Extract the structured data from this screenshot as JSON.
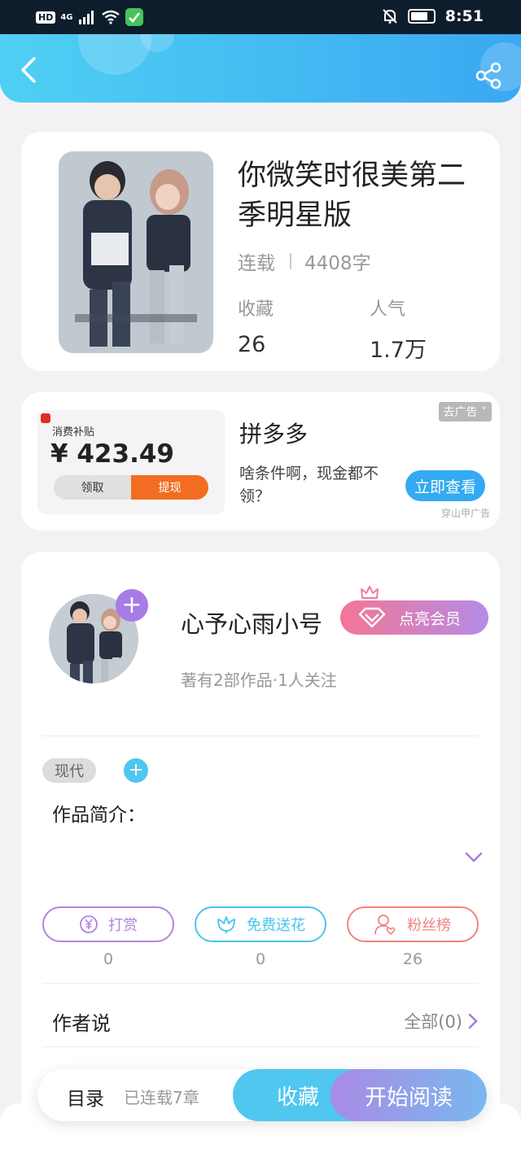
{
  "status_bar": {
    "hd": "HD",
    "network": "4G",
    "time": "8:51"
  },
  "book": {
    "title": "你微笑时很美第二季明星版",
    "status": "连载",
    "word_count": "4408字",
    "favorites_label": "收藏",
    "favorites_value": "26",
    "popularity_label": "人气",
    "popularity_value": "1.7万"
  },
  "ad": {
    "image_subtitle": "消费补贴",
    "image_amount": "¥ 423.49",
    "image_btn_claim": "领取",
    "image_btn_withdraw": "提现",
    "title": "拼多多",
    "description": "啥条件啊，现金都不领？",
    "close_label": "去广告",
    "cta": "立即查看",
    "source": "穿山甲广告"
  },
  "author": {
    "name": "心予心雨小号",
    "vip_label": "点亮会员",
    "stats": "著有2部作品·1人关注"
  },
  "tags": [
    "现代"
  ],
  "intro_label": "作品简介：",
  "actions": [
    {
      "label": "打赏",
      "count": "0",
      "color": "#b184e0"
    },
    {
      "label": "免费送花",
      "count": "0",
      "color": "#49c4ee"
    },
    {
      "label": "粉丝榜",
      "count": "26",
      "color": "#f0847e"
    }
  ],
  "author_says": {
    "label": "作者说",
    "all": "全部(0)"
  },
  "bottom_bar": {
    "toc_label": "目录",
    "toc_status": "已连载7章",
    "favorite_btn": "收藏",
    "read_btn": "开始阅读"
  },
  "colors": {
    "accent_blue": "#4fc7ef",
    "accent_purple": "#a77ce6"
  }
}
